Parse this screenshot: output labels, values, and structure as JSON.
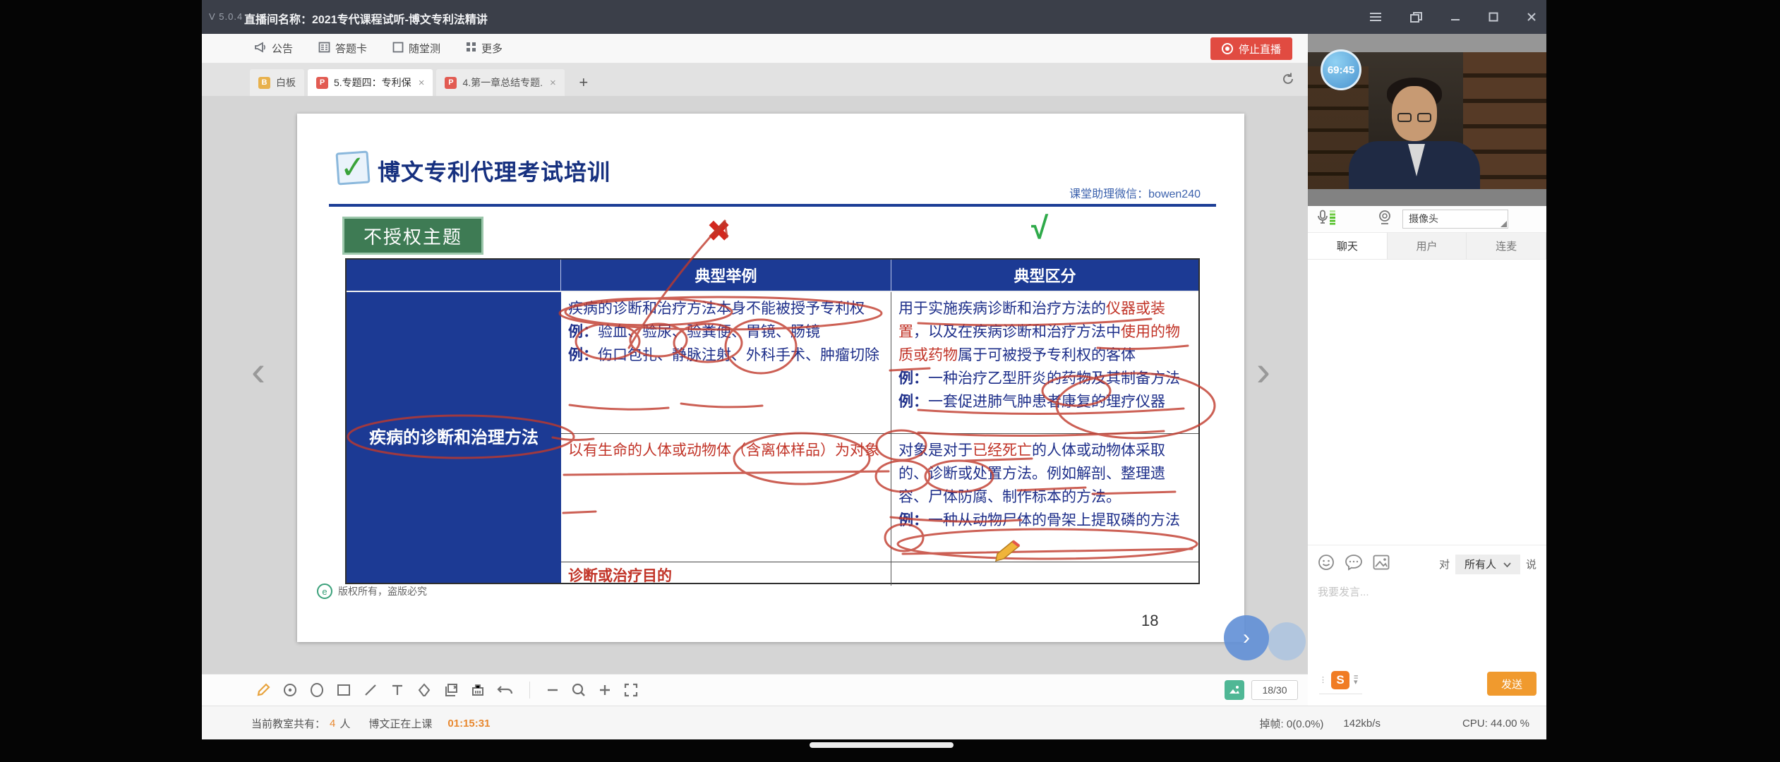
{
  "titlebar": {
    "version": "V 5.0.4",
    "title": "直播间名称：2021专代课程试听-博文专利法精讲"
  },
  "toolbar": {
    "items": [
      {
        "label": "公告"
      },
      {
        "label": "答题卡"
      },
      {
        "label": "随堂测"
      },
      {
        "label": "更多"
      }
    ],
    "stop_live": "停止直播"
  },
  "tabs": [
    {
      "icon_letter": "B",
      "label": "白板"
    },
    {
      "icon_letter": "P",
      "label": "5.专题四：专利保",
      "close": "×"
    },
    {
      "icon_letter": "P",
      "label": "4.第一章总结专题.",
      "close": "×"
    },
    {
      "plus": "+"
    }
  ],
  "slide": {
    "logo_check": "✓",
    "brand_title": "博文专利代理考试培训",
    "assistant": "课堂助理微信：bowen240",
    "badge": "不授权主题",
    "mark_wrong": "✖",
    "mark_right": "√",
    "copyright": "版权所有，盗版必究",
    "copyright_logo": "e",
    "page_number": "18",
    "table": {
      "header_examples": "典型举例",
      "header_distinction": "典型区分",
      "row_label": "疾病的诊断和治理方法",
      "ex_label": "例：",
      "r1c2_l1": "疾病的诊断和治疗方法本身不能被授予专利权",
      "r1c2_l2": "验血、验尿、验粪便、胃镜、肠镜",
      "r1c2_l3": "伤口包扎、静脉注射、外科手术、肿瘤切除",
      "r1c3_s1": "用于实施疾病诊断和治疗方法的",
      "r1c3_s2": "仪器或装置",
      "r1c3_s3": "，以及在疾病诊断和治疗方法中",
      "r1c3_s4": "使用的物质或药物",
      "r1c3_s5": "属于可被授予专利权的客体",
      "r1c3_ex1": "一种治疗乙型肝炎的药物及其制备方法",
      "r1c3_ex2": "一套促进肺气肿患者康复的理疗仪器",
      "r2c2": "以有生命的人体或动物体（含离体样品）为对象",
      "r2c3_s1": "对象是对于",
      "r2c3_s2": "已经死亡",
      "r2c3_s3": "的人体或动物体采取的、诊断或处置方法。例如解剖、整理遗容、尸体防腐、制作标本的方法。",
      "r2c3_ex": "一种从动物尸体的骨架上提取磷的方法",
      "r3c2": "诊断或治疗目的"
    }
  },
  "board": {
    "page_indicator": "18/30",
    "nav_prev": "‹",
    "nav_next": "›",
    "float_next": "›"
  },
  "status_bar": {
    "room_label": "当前教室共有：",
    "room_count": "4",
    "room_unit": "人",
    "teaching": "博文正在上课",
    "elapsed": "01:15:31",
    "frame_drop": "掉帧: 0(0.0%)",
    "bitrate": "142kb/s",
    "cpu": "CPU: 44.00 %"
  },
  "sidebar": {
    "timer": "69:45",
    "camera_select": "摄像头",
    "tab_chat": "聊天",
    "tab_users": "用户",
    "tab_mic": "连麦",
    "chat_to": "对",
    "chat_audience": "所有人",
    "chat_say": "说",
    "input_placeholder": "我要发言...",
    "send": "发送",
    "ime_letter": "S"
  },
  "colors": {
    "accent_red": "#e14b41",
    "table_blue": "#1c3a94",
    "annotation_red": "#c13327",
    "send_orange": "#f09a2e",
    "check_green": "#2faa4a",
    "badge_green": "#3e7b54",
    "timer_blue": "#58a7dd"
  }
}
